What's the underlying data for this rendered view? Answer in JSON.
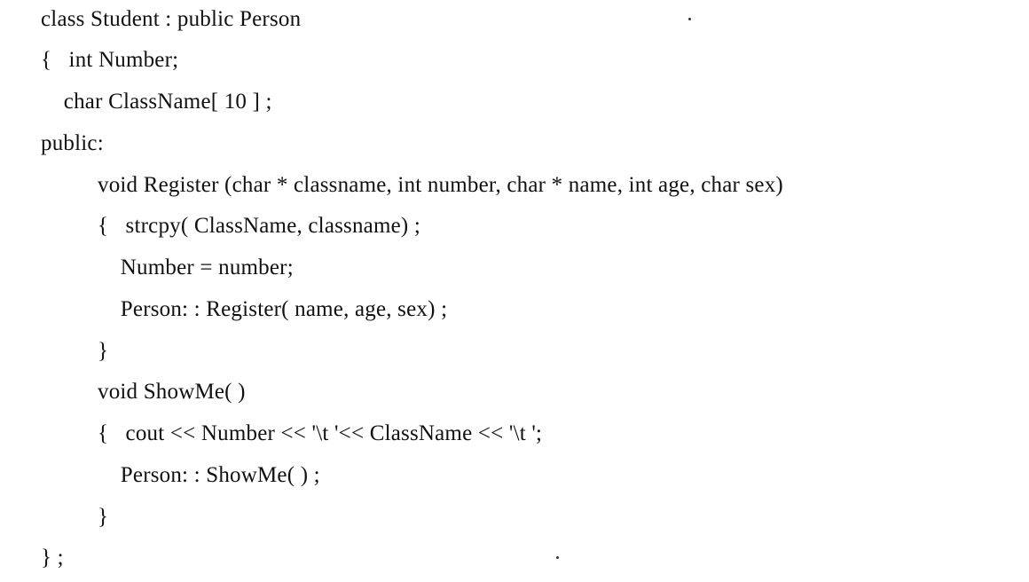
{
  "code": {
    "lines": [
      "class Student : public Person",
      "{   int Number;",
      "    char ClassName[ 10 ] ;",
      "public:",
      "void Register (char * classname, int number, char * name, int age, char sex)",
      "{   strcpy( ClassName, classname) ;",
      "    Number = number;",
      "    Person: : Register( name, age, sex) ;",
      "}",
      "void ShowMe( )",
      "{   cout << Number << '\\t '<< ClassName << '\\t ';",
      "    Person: : ShowMe( ) ;",
      "}",
      "} ;"
    ]
  }
}
